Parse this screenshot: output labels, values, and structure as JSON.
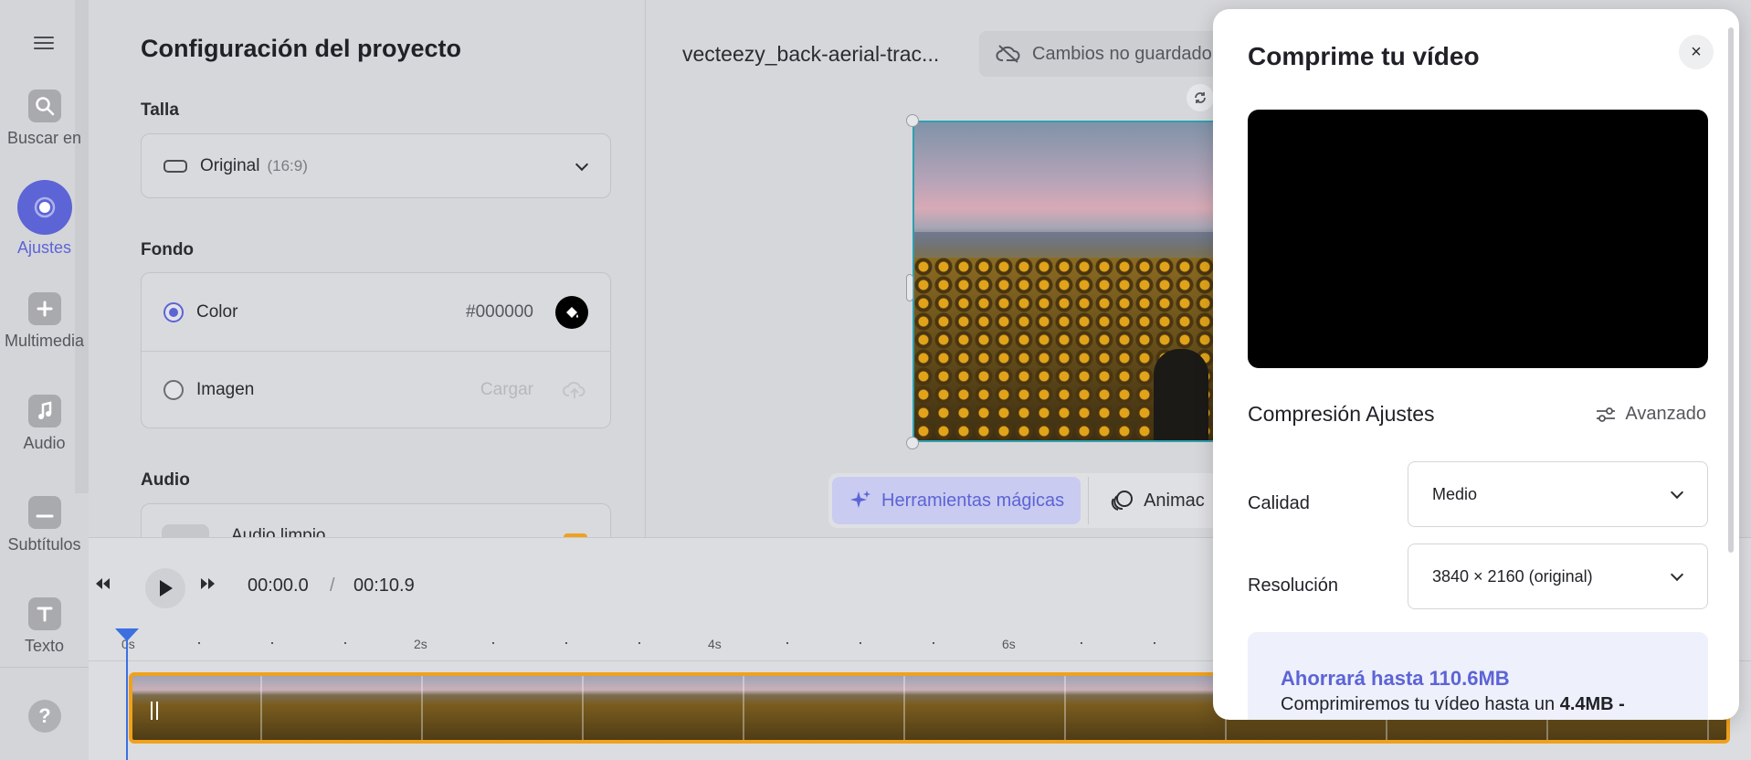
{
  "rail": {
    "items": [
      {
        "label": "Buscar en",
        "icon": "search-icon"
      },
      {
        "label": "Ajustes",
        "icon": "settings-icon",
        "active": true
      },
      {
        "label": "Multimedia",
        "icon": "plus-icon"
      },
      {
        "label": "Audio",
        "icon": "music-note-icon"
      },
      {
        "label": "Subtítulos",
        "icon": "subtitles-icon"
      },
      {
        "label": "Texto",
        "icon": "text-icon"
      }
    ],
    "help": "?"
  },
  "settings": {
    "title": "Configuración del proyecto",
    "size_label": "Talla",
    "size_value": "Original",
    "size_ratio": "(16:9)",
    "background_label": "Fondo",
    "color_option": "Color",
    "color_hex": "#000000",
    "image_option": "Imagen",
    "upload_label": "Cargar",
    "audio_label": "Audio",
    "audio_item": "Audio limpio"
  },
  "editor": {
    "filename": "vecteezy_back-aerial-trac...",
    "unsaved": "Cambios no guardado",
    "magic_tools": "Herramientas mágicas",
    "animation": "Animac"
  },
  "timeline": {
    "current_time": "00:00.0",
    "separator": "/",
    "total_time": "00:10.9",
    "ruler_labels": [
      "0s",
      "2s",
      "4s",
      "6s"
    ]
  },
  "modal": {
    "title": "Comprime tu vídeo",
    "close": "×",
    "section_title": "Compresión Ajustes",
    "advanced": "Avanzado",
    "quality_label": "Calidad",
    "quality_value": "Medio",
    "resolution_label": "Resolución",
    "resolution_value": "3840 × 2160 (original)",
    "savings_title": "Ahorrará hasta 110.6MB",
    "savings_text": "Comprimiremos tu vídeo hasta un",
    "savings_size": "4.4MB -"
  },
  "colors": {
    "accent": "#5c64d6",
    "clip_border": "#f0a11c",
    "playhead": "#3c6fe0"
  }
}
